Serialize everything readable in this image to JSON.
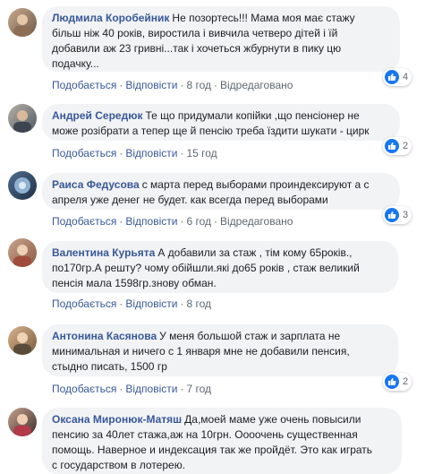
{
  "labels": {
    "like": "Подобається",
    "reply": "Відповісти",
    "edited": "Відредаговано",
    "dot": "·"
  },
  "colors": {
    "author": "#385898",
    "bubble": "#f2f3f5",
    "like_badge": "#1877f2"
  },
  "comments": [
    {
      "author": "Людмила Коробейник",
      "lines": [
        "Не позортесь!!! Мама моя має стажу",
        "більш ніж 40 років, виростила і вивчила четверо дітей і їй",
        "добавили аж 23 гривні...так і хочеться жбурнути в пику цю",
        "подачку..."
      ],
      "time": "8 год",
      "edited": true,
      "likes": "4"
    },
    {
      "author": "Андрей Середюк",
      "lines": [
        "Те що придумали копійки ,що пенсіонер не",
        "може розібрати а тепер ще й пенсію треба їздити шукати - цирк"
      ],
      "time": "15 год",
      "edited": false,
      "likes": "2"
    },
    {
      "author": "Раиса Федусова",
      "lines": [
        "с марта перед выборами проиндексируют а с",
        "апреля уже денег не будет. как всегда перед выборами"
      ],
      "time": "6 год",
      "edited": true,
      "likes": "3"
    },
    {
      "author": "Валентина Курьята",
      "lines": [
        "А добавили за стаж , тім кому 65років.,",
        "по170гр.А решту? чому обійшли.які до65 років , стаж великий",
        "пенсія мала 1598гр.знову обман."
      ],
      "time": "8 год",
      "edited": false,
      "likes": ""
    },
    {
      "author": "Антонина Касянова",
      "lines": [
        "У меня большой стаж и зарплата не",
        "минимальная и ничего с 1 января мне не добавили пенсия,",
        "стыдно писать, 1500 гр"
      ],
      "time": "7 год",
      "edited": false,
      "likes": "2"
    },
    {
      "author": "Оксана Миронюк-Матяш",
      "lines": [
        "Да,моей маме уже очень повысили",
        "пенсию за 40лет стажа,аж на 10грн. Оооочень существенная",
        "помощь. Наверное и индексация так же пройдёт. Это как играть",
        "с государством в лотерею."
      ],
      "time": "",
      "edited": false,
      "likes": ""
    }
  ]
}
